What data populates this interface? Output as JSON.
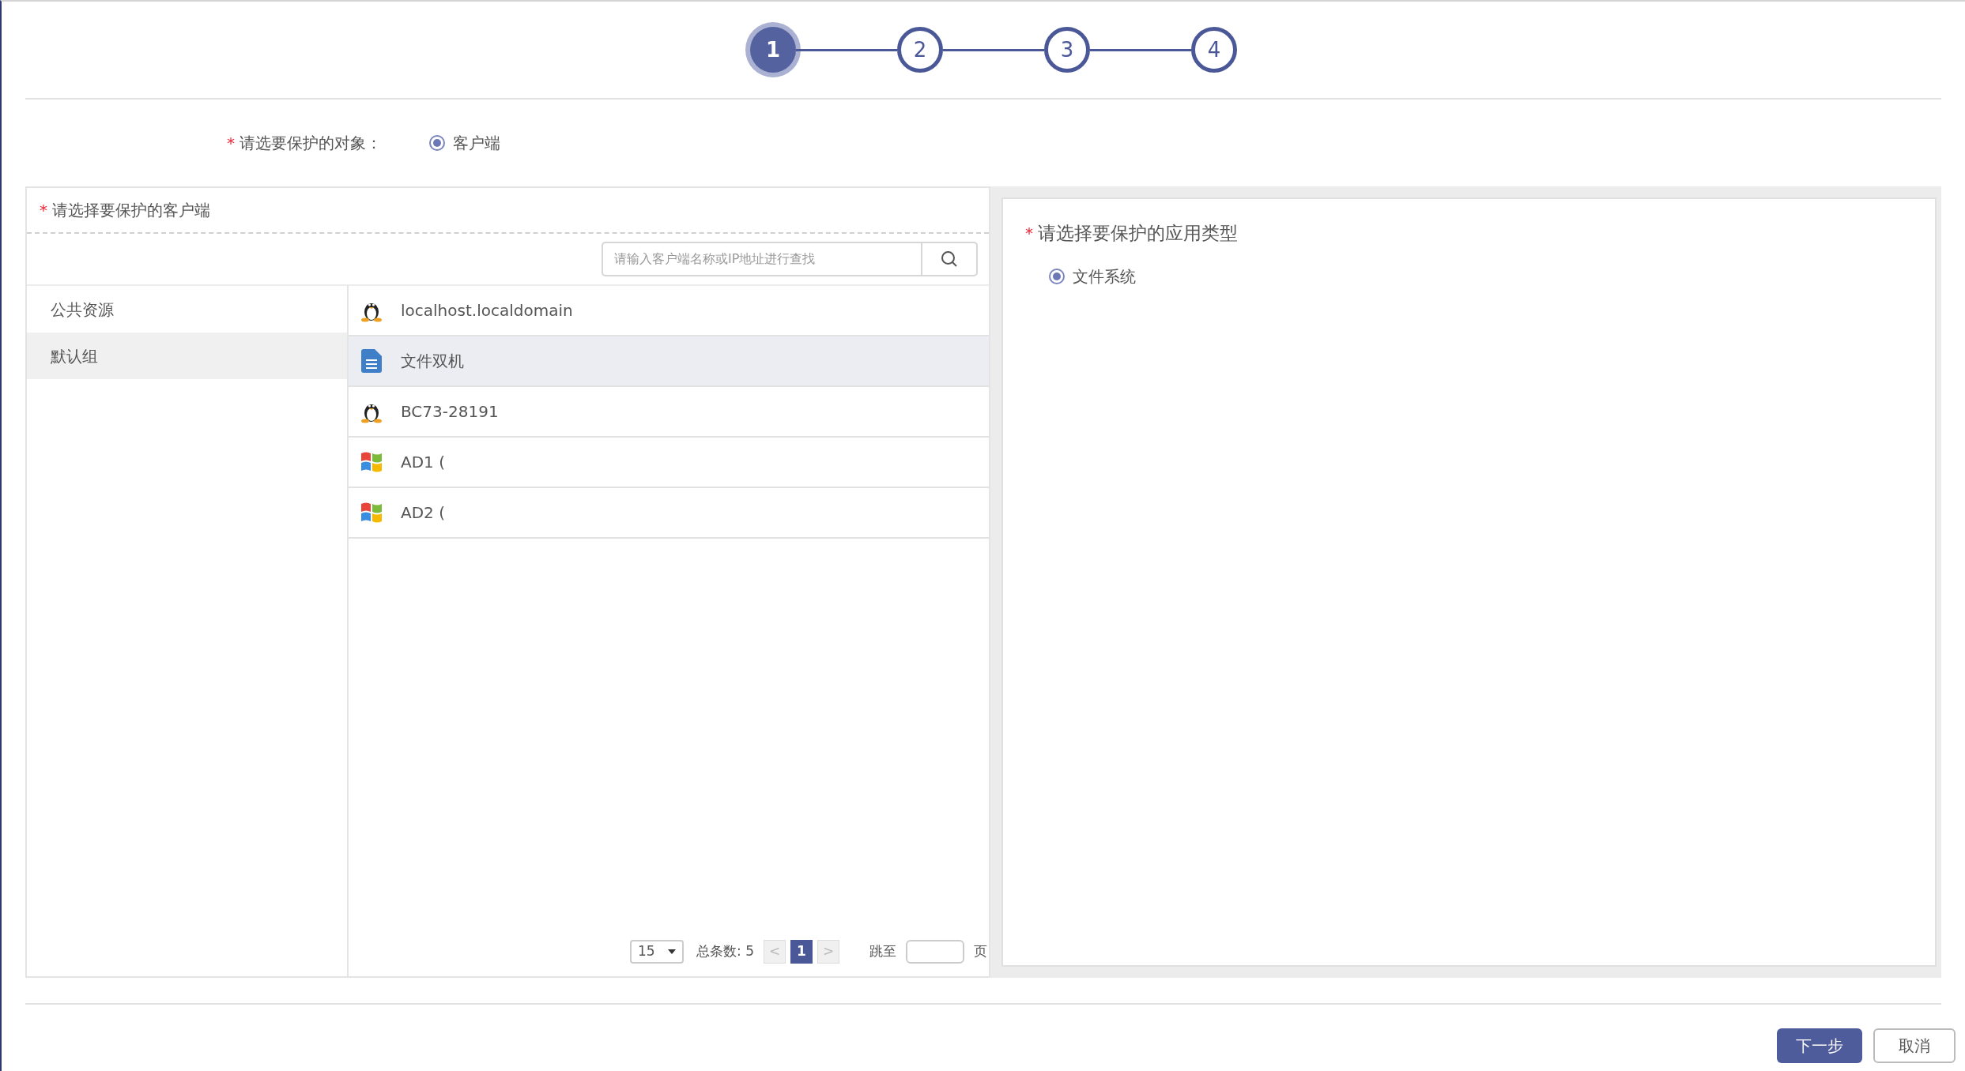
{
  "stepper": {
    "steps": [
      {
        "label": "1",
        "selected": true
      },
      {
        "label": "2",
        "selected": false
      },
      {
        "label": "3",
        "selected": false
      },
      {
        "label": "4",
        "selected": false
      }
    ]
  },
  "protect_target": {
    "required_mark": "*",
    "label": "请选要保护的对象：",
    "options": [
      {
        "label": "客户端",
        "selected": true
      }
    ]
  },
  "client_panel": {
    "required_mark": "*",
    "title": "请选择要保护的客户端",
    "search": {
      "placeholder": "请输入客户端名称或IP地址进行查找"
    },
    "groups": [
      {
        "label": "公共资源",
        "selected": false
      },
      {
        "label": "默认组",
        "selected": true
      }
    ],
    "clients": [
      {
        "name": "localhost.localdomain",
        "kind": "linux",
        "selected": false
      },
      {
        "name": "文件双机",
        "kind": "document",
        "selected": true
      },
      {
        "name": "BC73-28191",
        "kind": "linux",
        "selected": false
      },
      {
        "name": "AD1 (",
        "kind": "windows",
        "selected": false
      },
      {
        "name": "AD2 (",
        "kind": "windows",
        "selected": false
      }
    ],
    "pagination": {
      "page_size": "15",
      "total": "总条数: 5",
      "prev": "<",
      "pages": [
        {
          "label": "1",
          "selected": true
        }
      ],
      "next": ">",
      "jump_label": "跳至",
      "page_unit": "页"
    }
  },
  "app_panel": {
    "required_mark": "*",
    "title": "请选择要保护的应用类型",
    "options": [
      {
        "label": "文件系统",
        "selected": true
      }
    ]
  },
  "buttons": [
    {
      "label": "下一步",
      "kind": "primary"
    },
    {
      "label": "取消",
      "kind": "secondary"
    }
  ]
}
